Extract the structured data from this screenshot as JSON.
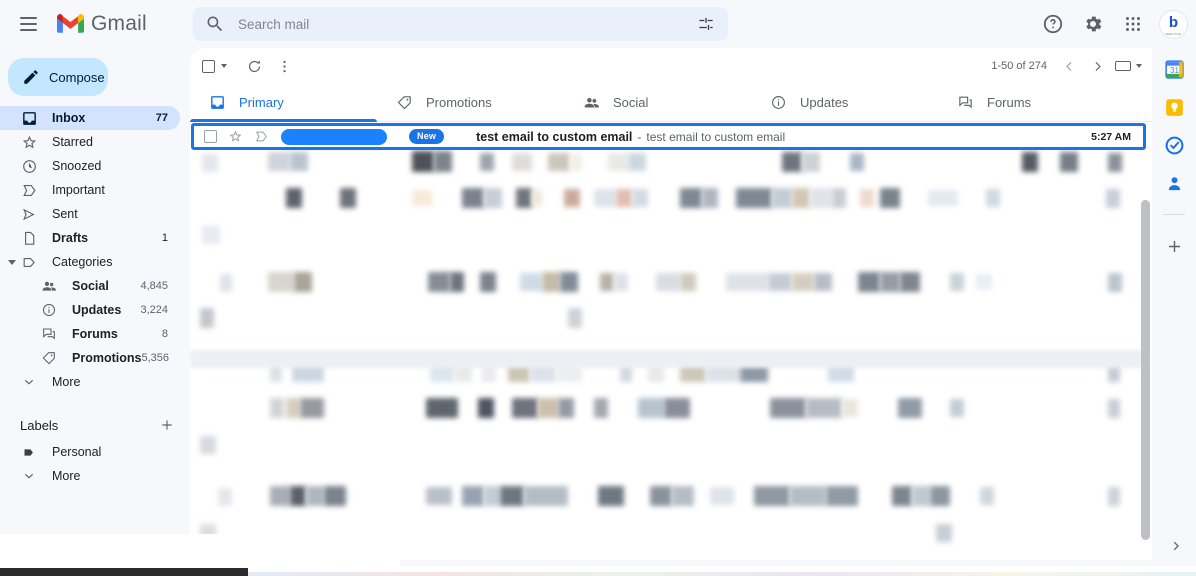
{
  "header": {
    "menu_icon": "hamburger-icon",
    "brand": "Gmail",
    "search_placeholder": "Search mail",
    "search_value": "",
    "search_icon": "search-icon",
    "filter_icon": "filter-options-icon",
    "help_icon": "help-icon",
    "settings_icon": "gear-icon",
    "apps_icon": "apps-grid-icon",
    "avatar_label": "b",
    "avatar_sub": "BOB.TOUR"
  },
  "sidebar": {
    "compose_label": "Compose",
    "compose_icon": "pencil-icon",
    "items": [
      {
        "label": "Inbox",
        "count": "77",
        "icon": "inbox-icon",
        "active": true
      },
      {
        "label": "Starred",
        "count": "",
        "icon": "star-icon",
        "active": false
      },
      {
        "label": "Snoozed",
        "count": "",
        "icon": "clock-icon",
        "active": false
      },
      {
        "label": "Important",
        "count": "",
        "icon": "label-important-icon",
        "active": false
      },
      {
        "label": "Sent",
        "count": "",
        "icon": "send-icon",
        "active": false
      },
      {
        "label": "Drafts",
        "count": "1",
        "icon": "draft-icon",
        "active": false,
        "bold": true
      },
      {
        "label": "Categories",
        "count": "",
        "icon": "category-tag-icon",
        "active": false,
        "expandable": true
      }
    ],
    "categories": [
      {
        "label": "Social",
        "count": "4,845",
        "icon": "people-icon"
      },
      {
        "label": "Updates",
        "count": "3,224",
        "icon": "info-icon"
      },
      {
        "label": "Forums",
        "count": "8",
        "icon": "forum-icon"
      },
      {
        "label": "Promotions",
        "count": "5,356",
        "icon": "tag-icon"
      }
    ],
    "more_label": "More",
    "more_icon": "chevron-down-icon",
    "labels_title": "Labels",
    "labels_plus_icon": "plus-icon",
    "labels": [
      {
        "label": "Personal",
        "icon": "label-icon"
      }
    ],
    "labels_more": "More",
    "labels_more_icon": "chevron-down-icon"
  },
  "toolbar": {
    "select_all_icon": "checkbox-icon",
    "select_caret_icon": "chevron-down-icon",
    "refresh_icon": "refresh-icon",
    "more_options_icon": "more-vertical-icon",
    "pager_text": "1-50 of 274",
    "prev_icon": "chevron-left-icon",
    "next_icon": "chevron-right-icon",
    "input_tools_icon": "keyboard-icon",
    "input_tools_caret": "chevron-down-icon"
  },
  "tabs": [
    {
      "label": "Primary",
      "icon": "inbox-tab-icon",
      "active": true
    },
    {
      "label": "Promotions",
      "icon": "tag-icon",
      "active": false
    },
    {
      "label": "Social",
      "icon": "people-icon",
      "active": false
    },
    {
      "label": "Updates",
      "icon": "info-icon",
      "active": false
    },
    {
      "label": "Forums",
      "icon": "forum-icon",
      "active": false
    }
  ],
  "selected_email": {
    "checkbox_icon": "checkbox-icon",
    "star_icon": "star-outline-icon",
    "important_icon": "label-important-outline-icon",
    "sender_redacted": true,
    "badge": "New",
    "subject": "test email to custom email",
    "separator": "-",
    "snippet": "test email to custom email",
    "time": "5:27 AM"
  },
  "rail": {
    "items": [
      {
        "icon": "google-calendar-icon"
      },
      {
        "icon": "google-keep-icon"
      },
      {
        "icon": "google-tasks-icon"
      },
      {
        "icon": "google-contacts-icon"
      }
    ],
    "add_icon": "plus-icon",
    "expand_icon": "chevron-right-icon"
  },
  "colors": {
    "accent": "#1a73e8",
    "badge": "#1a73e8",
    "redaction": "#1a82ff",
    "sidebar_active": "#d3e3fd",
    "compose": "#c2e7ff",
    "surface": "#ffffff",
    "background": "#f6f8fc"
  }
}
